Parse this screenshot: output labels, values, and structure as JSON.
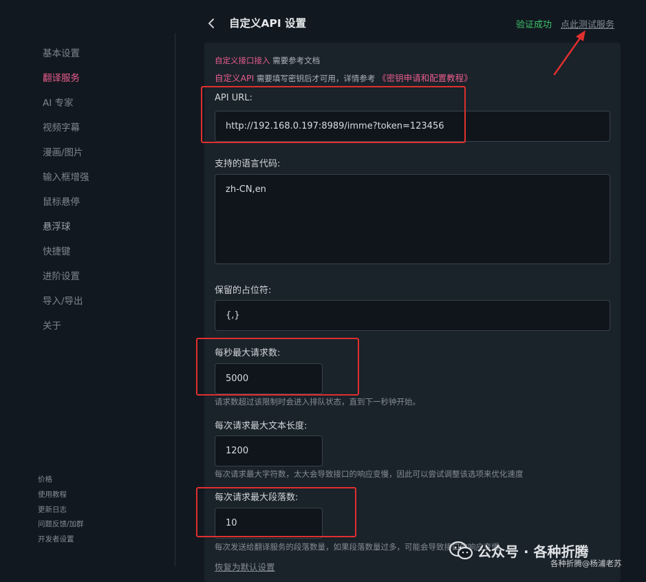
{
  "sidebar": {
    "items": [
      {
        "label": "基本设置"
      },
      {
        "label": "翻译服务"
      },
      {
        "label": "AI 专家"
      },
      {
        "label": "视频字幕"
      },
      {
        "label": "漫画/图片"
      },
      {
        "label": "输入框增强"
      },
      {
        "label": "鼠标悬停"
      },
      {
        "label": "悬浮球"
      },
      {
        "label": "快捷键"
      },
      {
        "label": "进阶设置"
      },
      {
        "label": "导入/导出"
      },
      {
        "label": "关于"
      }
    ],
    "footer": [
      {
        "label": "价格"
      },
      {
        "label": "使用教程"
      },
      {
        "label": "更新日志"
      },
      {
        "label": "问题反馈/加群"
      },
      {
        "label": "开发者设置"
      }
    ]
  },
  "header": {
    "title": "自定义API 设置",
    "status": "验证成功",
    "test_link": "点此测试服务"
  },
  "intro": {
    "line1_link": "自定义接口接入",
    "line1_text": "需要参考文档",
    "line2_link": "自定义API",
    "line2_text": "需要填写密钥后才可用，详情参考",
    "line2_doc": "《密钥申请和配置教程》"
  },
  "form": {
    "api_url": {
      "label": "API URL:",
      "value": "http://192.168.0.197:8989/imme?token=123456"
    },
    "lang_codes": {
      "label": "支持的语言代码:",
      "value": "zh-CN,en"
    },
    "placeholder_chars": {
      "label": "保留的占位符:",
      "value": "{,}"
    },
    "max_rps": {
      "label": "每秒最大请求数:",
      "value": "5000",
      "help": "请求数超过该限制时会进入排队状态，直到下一秒钟开始。"
    },
    "max_text_len": {
      "label": "每次请求最大文本长度:",
      "value": "1200",
      "help": "每次请求最大字符数，太大会导致接口的响应变慢，因此可以尝试调整该选项来优化速度"
    },
    "max_paragraphs": {
      "label": "每次请求最大段落数:",
      "value": "10",
      "help": "每次发送给翻译服务的段落数量，如果段落数量过多，可能会导致接口的响应变慢"
    },
    "reset_label": "恢复为默认设置"
  },
  "watermark": {
    "main": "公众号 · 各种折腾",
    "sub": "各种折腾@杨浦老苏"
  },
  "colors": {
    "accent": "#e85d8c",
    "success": "#3ec46d",
    "annotation": "#e0302f"
  }
}
